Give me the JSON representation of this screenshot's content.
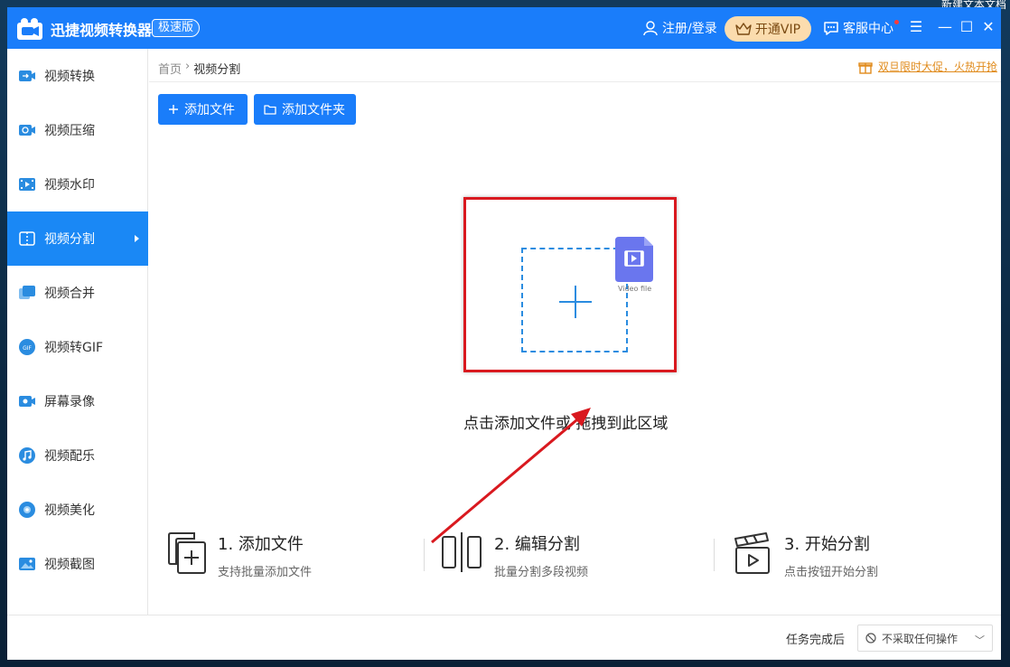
{
  "desktop": {
    "corner_text": "新建文本文档"
  },
  "app": {
    "title": "迅捷视频转换器",
    "edition": "极速版",
    "login_label": "注册/登录",
    "vip_label": "开通VIP",
    "service_label": "客服中心",
    "accent_color": "#1a7dfa"
  },
  "window_controls": {
    "menu": "☰",
    "minimize": "—",
    "maximize": "☐",
    "close": "✕"
  },
  "sidebar": {
    "items": [
      {
        "label": "视频转换",
        "icon": "video-convert-icon"
      },
      {
        "label": "视频压缩",
        "icon": "video-compress-icon"
      },
      {
        "label": "视频水印",
        "icon": "video-watermark-icon"
      },
      {
        "label": "视频分割",
        "icon": "video-split-icon",
        "active": true
      },
      {
        "label": "视频合并",
        "icon": "video-merge-icon"
      },
      {
        "label": "视频转GIF",
        "icon": "gif-icon"
      },
      {
        "label": "屏幕录像",
        "icon": "screen-record-icon"
      },
      {
        "label": "视频配乐",
        "icon": "music-icon"
      },
      {
        "label": "视频美化",
        "icon": "beautify-icon"
      },
      {
        "label": "视频截图",
        "icon": "screenshot-icon"
      }
    ]
  },
  "breadcrumb": {
    "home": "首页",
    "separator": "›",
    "current": "视频分割"
  },
  "promo": {
    "text": "双旦限时大促，火热开抢"
  },
  "toolbar": {
    "add_file": "添加文件",
    "add_folder": "添加文件夹"
  },
  "dropzone": {
    "file_label": "Video file",
    "hint": "点击添加文件或 拖拽到此区域"
  },
  "steps": [
    {
      "title": "1. 添加文件",
      "desc": "支持批量添加文件"
    },
    {
      "title": "2. 编辑分割",
      "desc": "批量分割多段视频"
    },
    {
      "title": "3. 开始分割",
      "desc": "点击按钮开始分割"
    }
  ],
  "footer": {
    "after_task_label": "任务完成后",
    "after_task_value": "不采取任何操作"
  }
}
